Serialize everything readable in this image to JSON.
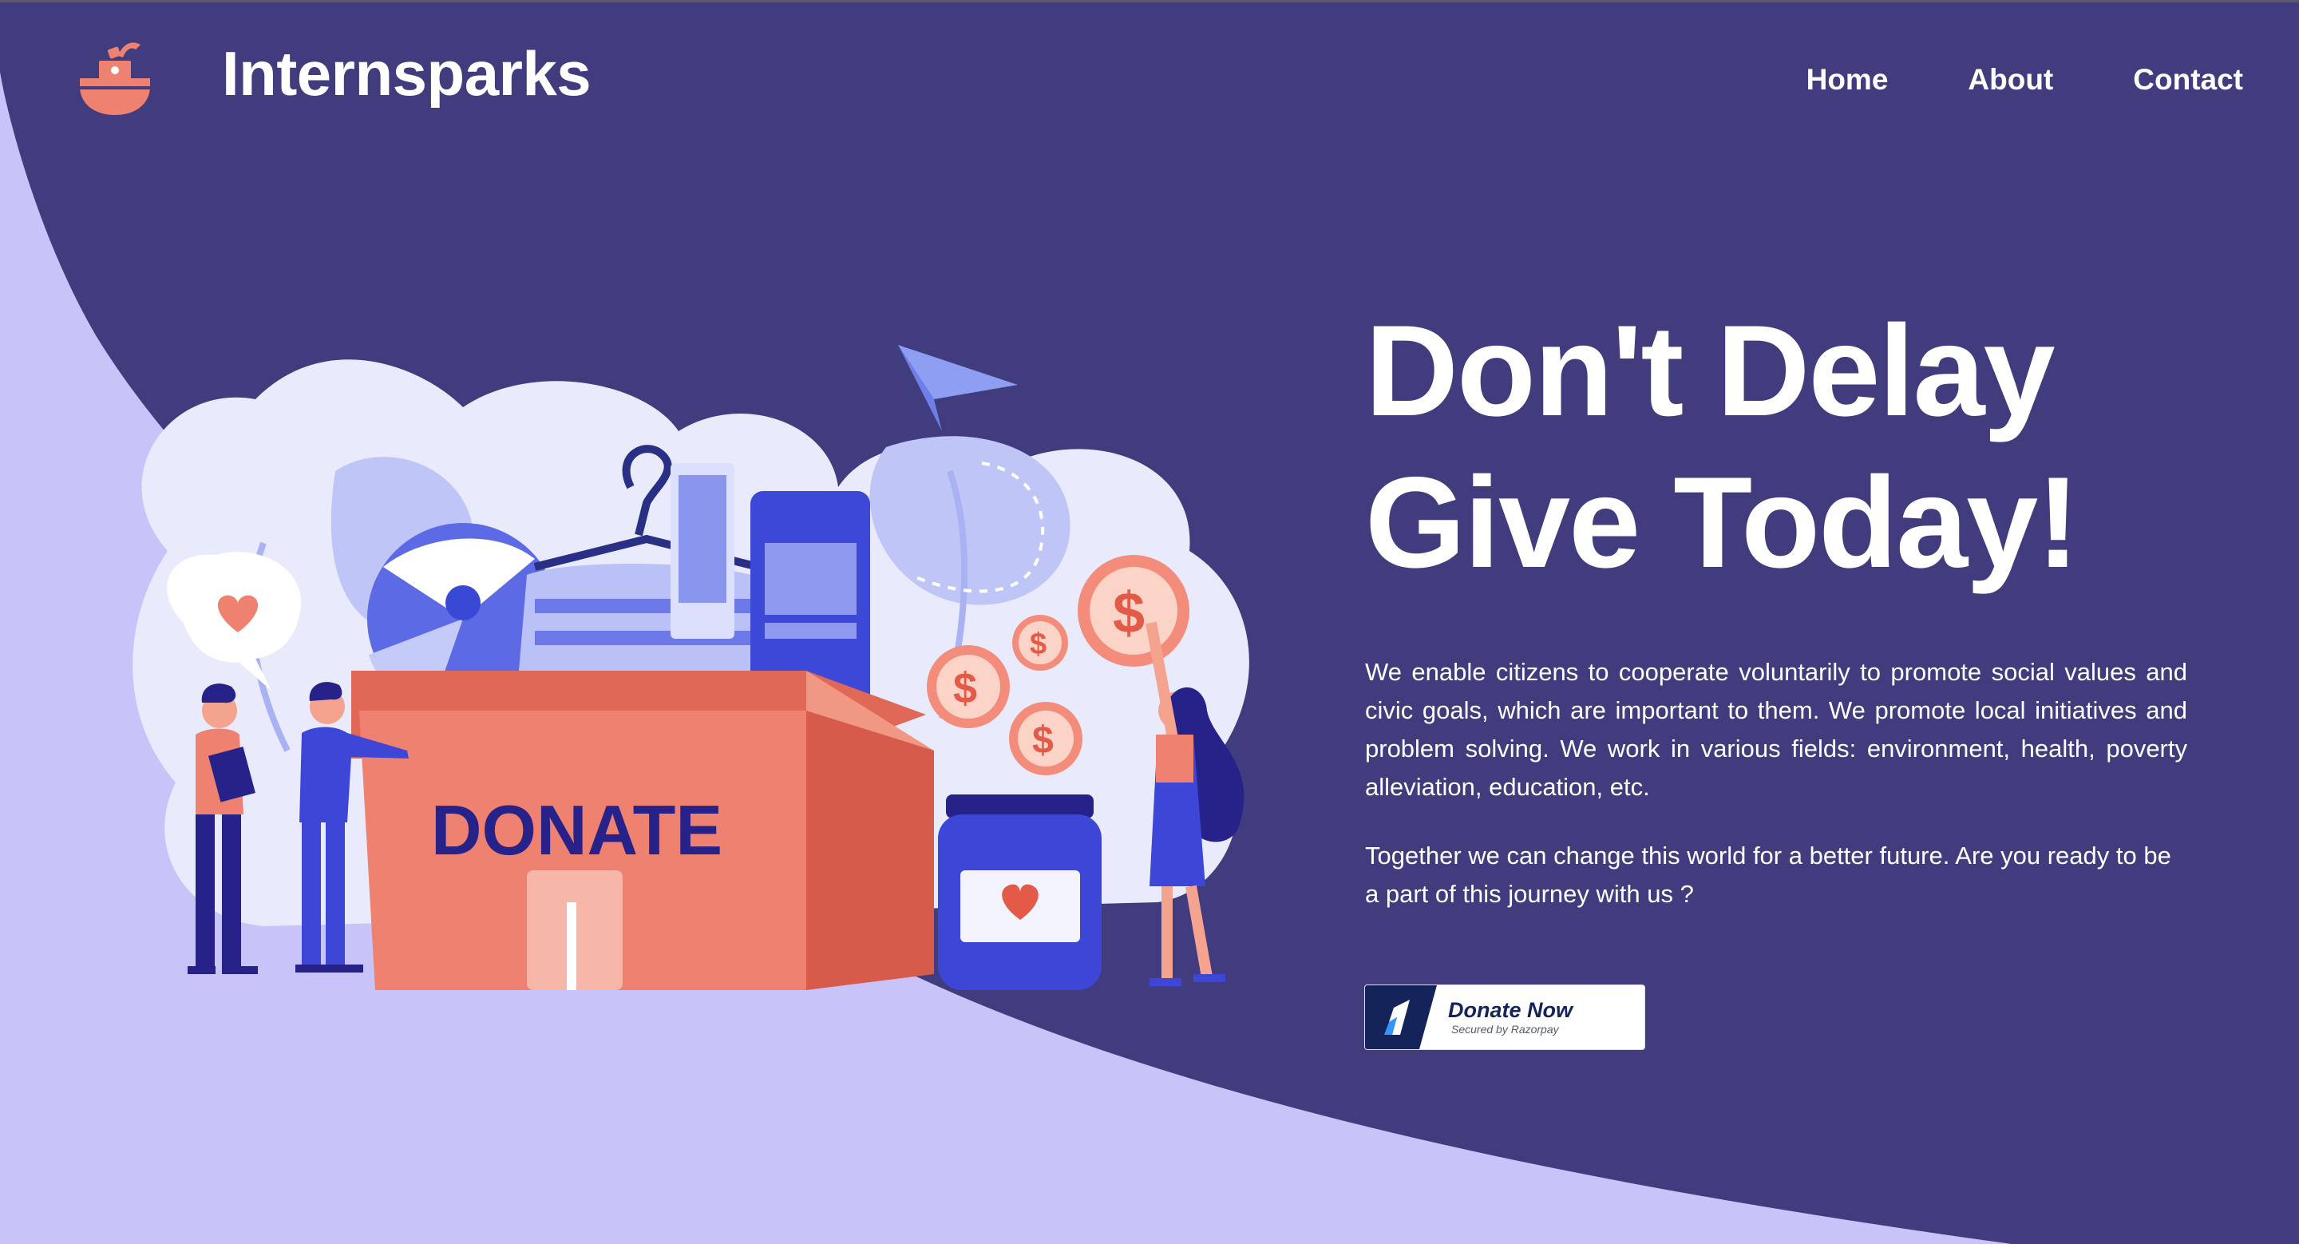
{
  "header": {
    "brand": "Internsparks",
    "nav": [
      "Home",
      "About",
      "Contact"
    ]
  },
  "hero": {
    "headline_line1": "Don't Delay",
    "headline_line2": "Give Today!",
    "paragraph1": "We enable citizens to cooperate voluntarily to promote social values and civic goals, which are important to them. We promote local initiatives and problem solving. We work in various fields: environment, health, poverty alleviation, education, etc.",
    "paragraph2": "Together we can change this world for a better future. Are you ready to be a part of this journey with us ?"
  },
  "illustration": {
    "box_label": "DONATE",
    "coin_symbol": "$"
  },
  "donate_button": {
    "title": "Donate Now",
    "subtitle": "Secured by Razorpay"
  },
  "colors": {
    "navy": "#403c7e",
    "lavender": "#c8c3f8",
    "coral": "#ee8170",
    "white": "#ffffff"
  },
  "icons": {
    "logo": "donation-box-logo-icon",
    "razorpay": "razorpay-logo-icon"
  }
}
